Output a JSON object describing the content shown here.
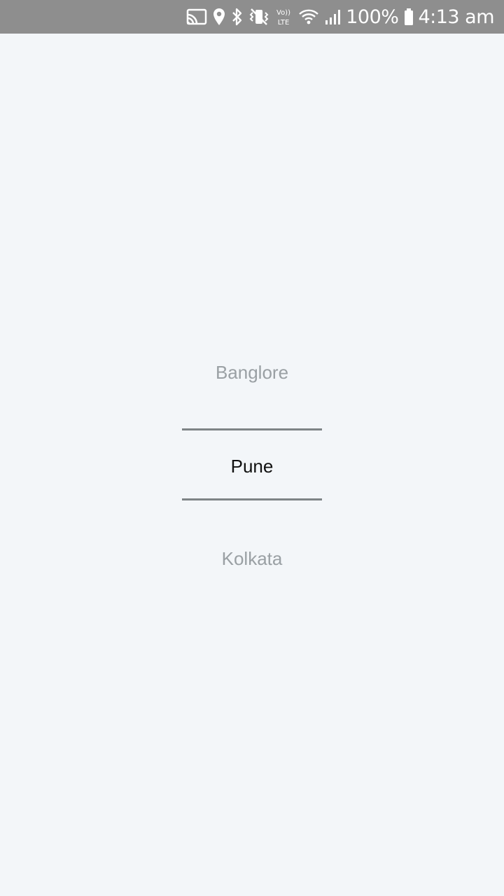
{
  "status_bar": {
    "icons": [
      "cast-icon",
      "location-icon",
      "bluetooth-icon",
      "vibrate-icon",
      "volte-icon",
      "wifi-icon",
      "signal-icon",
      "battery-icon"
    ],
    "volte_label_top": "Vo))",
    "volte_label_bottom": "LTE",
    "battery": "100%",
    "time": "4:13 am"
  },
  "picker": {
    "items": [
      "Banglore",
      "Pune",
      "Kolkata"
    ],
    "selected": "Pune"
  },
  "colors": {
    "status_bar": "#8e8e8e",
    "background": "#f3f6f9",
    "selected_text": "#111111",
    "unselected_text": "#9aa0a4",
    "divider": "#7e8486"
  }
}
